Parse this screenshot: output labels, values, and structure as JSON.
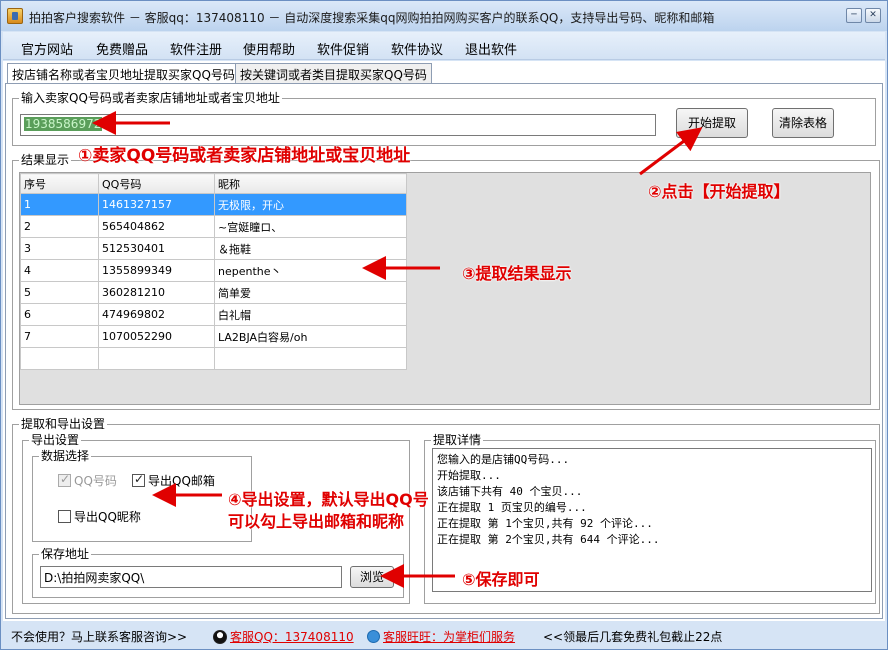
{
  "window": {
    "title": "拍拍客户搜索软件 － 客服qq：137408110 － 自动深度搜索采集qq网购拍拍网购买客户的联系QQ，支持导出号码、昵称和邮箱",
    "min_glyph": "─",
    "close_glyph": "✕"
  },
  "menu": [
    "官方网站",
    "免费赠品",
    "软件注册",
    "使用帮助",
    "软件促销",
    "软件协议",
    "退出软件"
  ],
  "tabs": [
    "按店铺名称或者宝贝地址提取买家QQ号码",
    "按关键词或者类目提取买家QQ号码"
  ],
  "input_group": {
    "label": "输入卖家QQ号码或者卖家店铺地址或者宝贝地址",
    "value": "1938586972",
    "start_button": "开始提取",
    "clear_button": "清除表格"
  },
  "results": {
    "label": "结果显示",
    "columns": [
      "序号",
      "QQ号码",
      "昵称"
    ],
    "rows": [
      [
        "1",
        "1461327157",
        "无极限，开心"
      ],
      [
        "2",
        "565404862",
        "~宫娗瞳ロ、"
      ],
      [
        "3",
        "512530401",
        "＆拖鞋"
      ],
      [
        "4",
        "1355899349",
        "nepenthe丶"
      ],
      [
        "5",
        "360281210",
        "简单爱"
      ],
      [
        "6",
        "474969802",
        "白礼帽"
      ],
      [
        "7",
        "1070052290",
        "LA2BJA白容易/oh"
      ]
    ]
  },
  "settings": {
    "label": "提取和导出设置",
    "export_label": "导出设置",
    "data_select_label": "数据选择",
    "cb_qq": "QQ号码",
    "cb_email": "导出QQ邮箱",
    "cb_nick": "导出QQ昵称",
    "save_label": "保存地址",
    "save_path": "D:\\拍拍网卖家QQ\\",
    "browse_button": "浏览"
  },
  "details": {
    "label": "提取详情",
    "lines": [
      "您输入的是店铺QQ号码...",
      "开始提取...",
      "该店铺下共有 40 个宝贝...",
      "正在提取 1 页宝贝的编号...",
      "正在提取 第 1个宝贝,共有 92 个评论...",
      "正在提取 第 2个宝贝,共有 644 个评论..."
    ]
  },
  "annotations": {
    "a1": "①卖家QQ号码或者卖家店铺地址或宝贝地址",
    "a2": "②点击【开始提取】",
    "a3": "③提取结果显示",
    "a4_line1": "④导出设置，默认导出QQ号",
    "a4_line2": "可以勾上导出邮箱和昵称",
    "a5": "⑤保存即可"
  },
  "statusbar": {
    "help": "不会使用？马上联系客服咨询>>",
    "qq_link": "客服QQ：137408110",
    "ww_link": "客服旺旺：为掌柜们服务",
    "promo": "<<领最后几套免费礼包截止22点"
  },
  "colors": {
    "annotation": "#e00000",
    "selection": "#3399ff",
    "input_value": "#7fd17f"
  }
}
